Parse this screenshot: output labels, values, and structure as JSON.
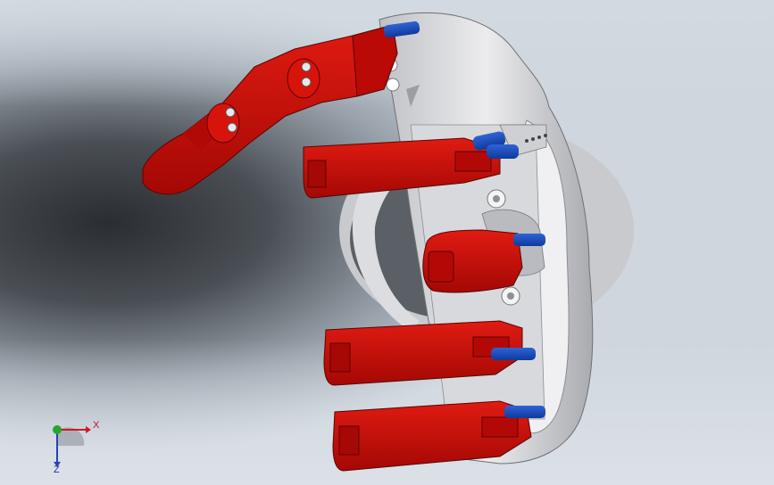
{
  "viewport": {
    "background_top": "#cfd6dd",
    "background_center_dark": "#2a2d31",
    "part_red": "#cc0b07",
    "part_red_shade": "#7a0703",
    "housing_gray": "#e7e7e9",
    "housing_shade": "#9c9ea3",
    "pin_blue": "#1846b7"
  },
  "triad": {
    "x_label": "X",
    "z_label": "Z",
    "x_color": "#d41820",
    "y_color": "#25a52a",
    "z_color": "#2a3fbf"
  }
}
